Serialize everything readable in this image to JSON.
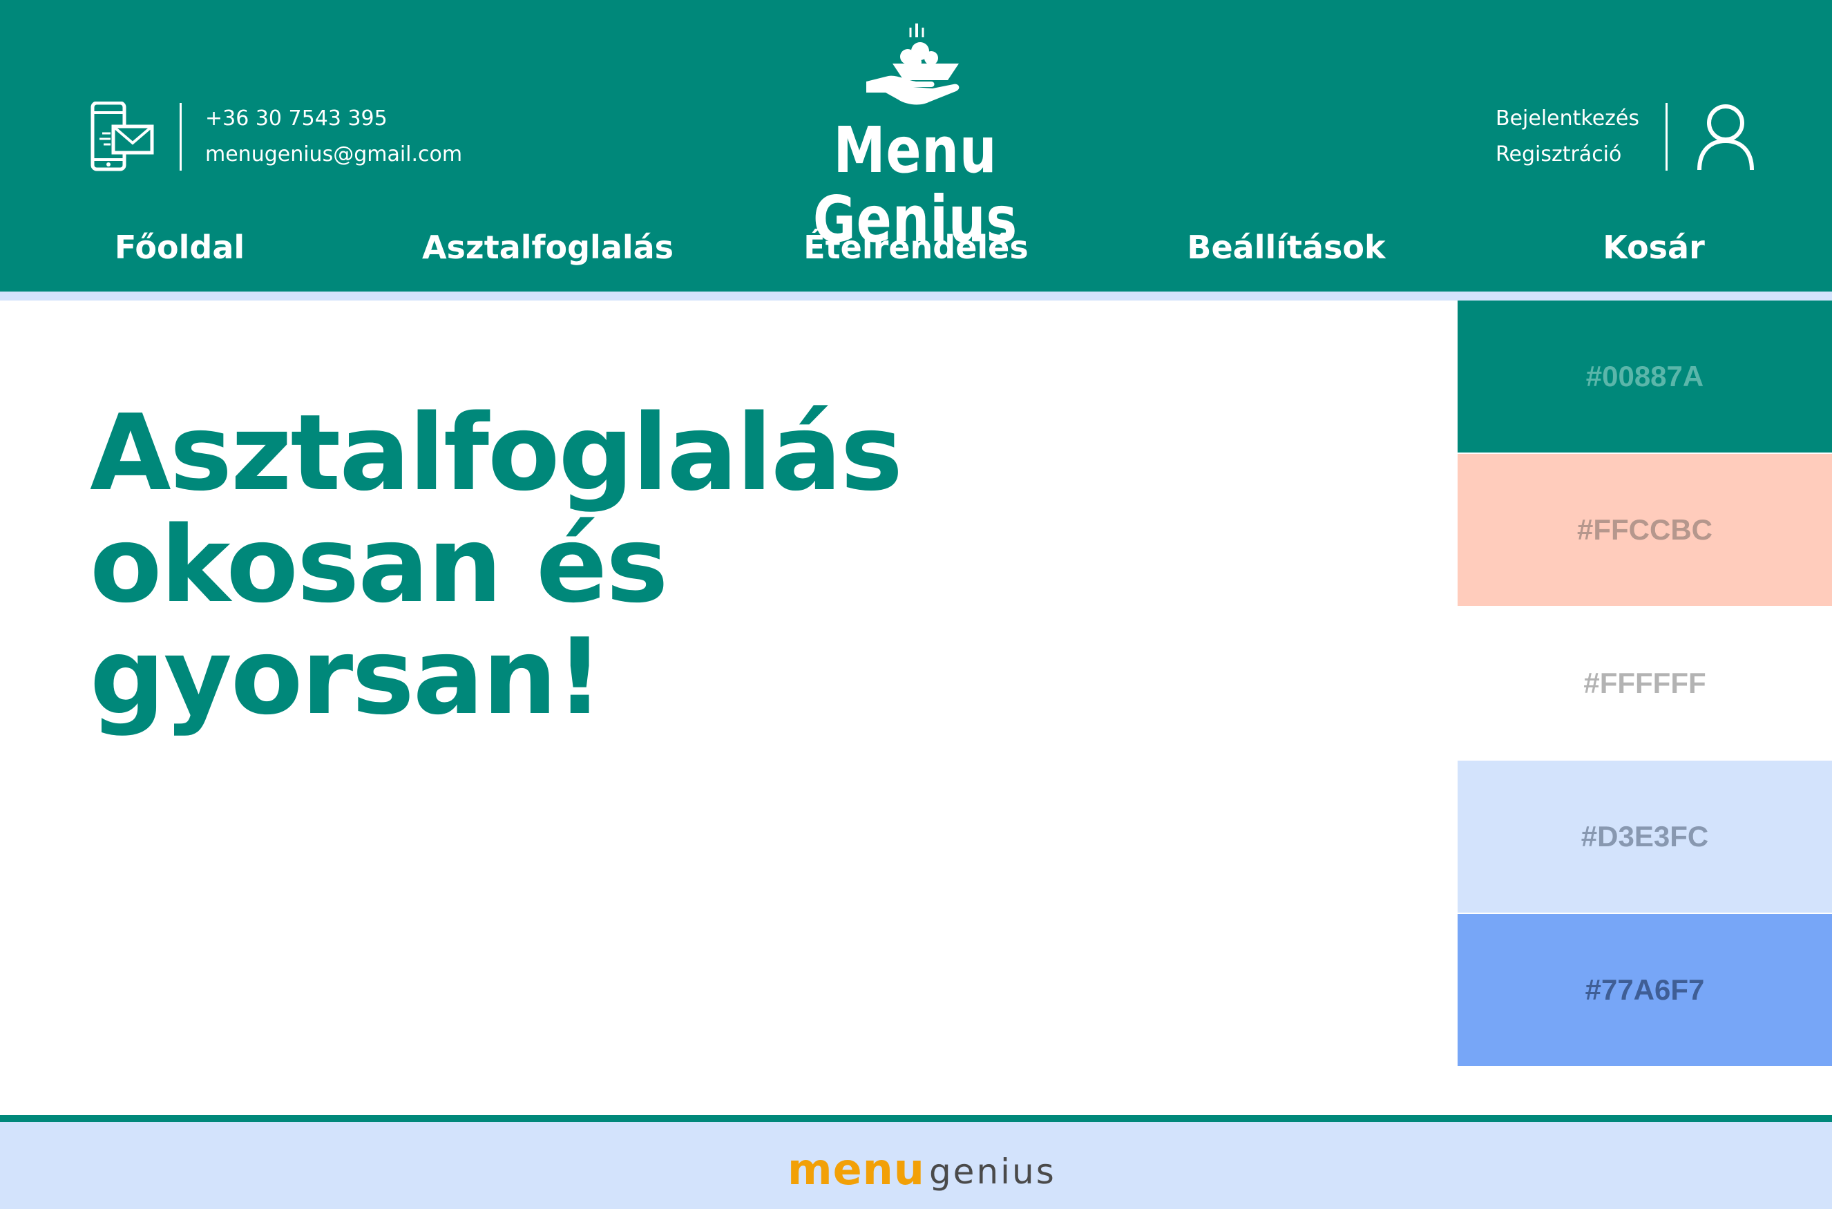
{
  "header": {
    "contact": {
      "phone": "+36 30 7543 395",
      "email": "menugenius@gmail.com",
      "icon": "phone-mail-icon"
    },
    "brand": {
      "title": "Menu Genius",
      "icon": "serving-hand-icon"
    },
    "account": {
      "login_label": "Bejelentkezés",
      "register_label": "Regisztráció",
      "icon": "user-icon"
    }
  },
  "nav": {
    "items": [
      {
        "label": "Főoldal"
      },
      {
        "label": "Asztalfoglalás"
      },
      {
        "label": "Ételrendelés"
      },
      {
        "label": "Beállítások"
      },
      {
        "label": "Kosár"
      }
    ]
  },
  "hero": {
    "lines": [
      "Asztalfoglalás",
      "okosan és",
      "gyorsan!"
    ]
  },
  "palette": {
    "swatches": [
      {
        "label": "#00887A",
        "color": "#00887A",
        "text_color": "#5BB6AA"
      },
      {
        "label": "#FFCCBC",
        "color": "#FFCCBC",
        "text_color": "#B5978D"
      },
      {
        "label": "#FFFFFF",
        "color": "#FFFFFF",
        "text_color": "#B3B3B3"
      },
      {
        "label": "#D3E3FC",
        "color": "#D3E3FC",
        "text_color": "#8898B0"
      },
      {
        "label": "#77A6F7",
        "color": "#77A6F7",
        "text_color": "#3F5E95"
      }
    ]
  },
  "footer": {
    "logo_menu": "menu",
    "logo_genius": "genius"
  },
  "colors": {
    "primary": "#00887A",
    "accent_light": "#D3E3FC",
    "logo_orange": "#F2A007"
  }
}
